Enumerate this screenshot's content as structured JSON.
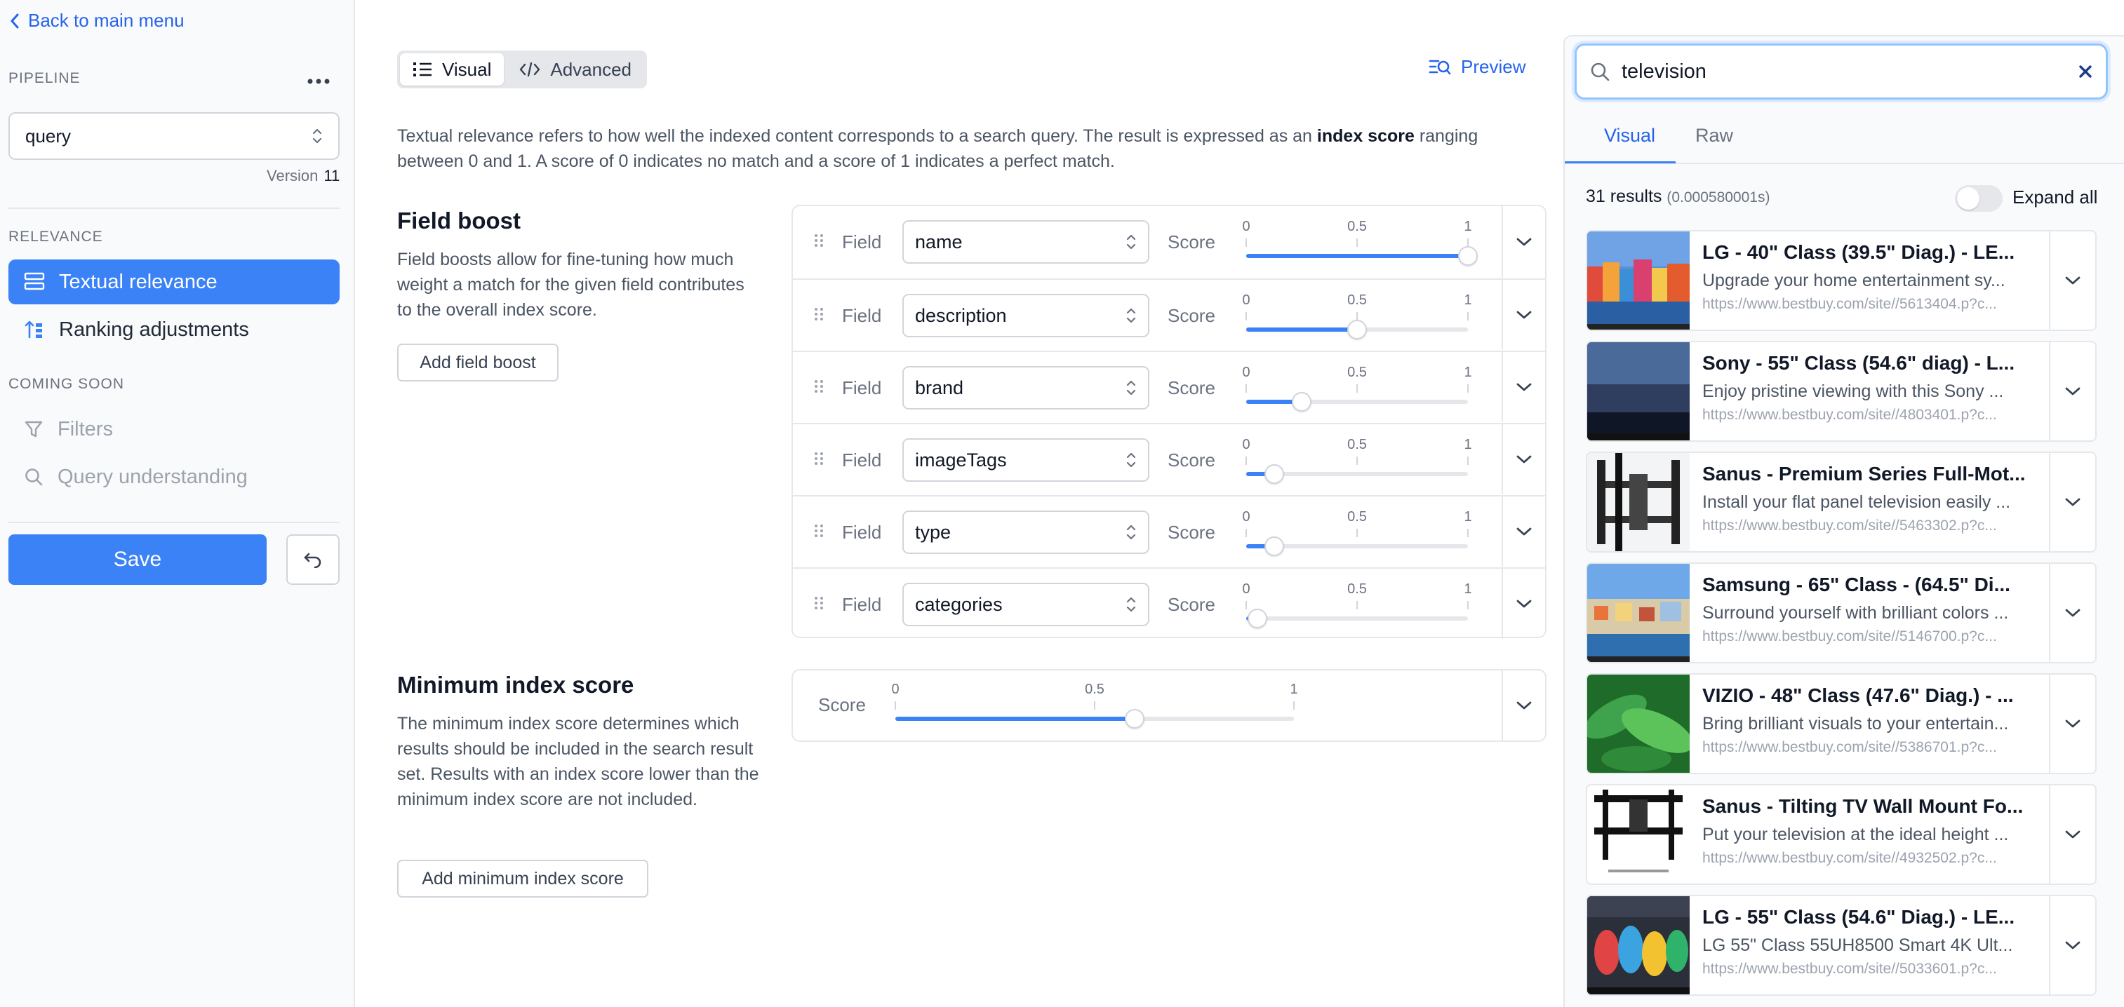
{
  "sidebar": {
    "back_label": "Back to main menu",
    "pipeline_title": "PIPELINE",
    "pipeline_value": "query",
    "version_label": "Version",
    "version_number": "11",
    "relevance_title": "RELEVANCE",
    "relevance_items": [
      {
        "label": "Textual relevance",
        "icon": "list-icon",
        "active": true
      },
      {
        "label": "Ranking adjustments",
        "icon": "sort-icon",
        "active": false
      }
    ],
    "coming_soon_title": "COMING SOON",
    "coming_soon_items": [
      {
        "label": "Filters",
        "icon": "filter-icon"
      },
      {
        "label": "Query understanding",
        "icon": "search-icon"
      }
    ],
    "save_label": "Save",
    "undo_icon": "undo-icon"
  },
  "main": {
    "mode_tabs": [
      {
        "label": "Visual",
        "icon": "list-icon",
        "active": true
      },
      {
        "label": "Advanced",
        "icon": "code-icon",
        "active": false
      }
    ],
    "preview_label": "Preview",
    "intro_text": "Textual relevance refers to how well the indexed content corresponds to a search query. The result is expressed as an",
    "intro_bold": "index score",
    "intro_text_2": "ranging between 0 and 1. A score of 0 indicates no match and a score of 1 indicates a perfect match.",
    "field_boost": {
      "title": "Field boost",
      "description": "Field boosts allow for fine-tuning how much weight a match for the given field contributes to the overall index score.",
      "add_label": "Add field boost",
      "field_label": "Field",
      "score_label": "Score",
      "tick_labels": [
        "0",
        "0.5",
        "1"
      ],
      "rows": [
        {
          "field": "name",
          "score": 1.0
        },
        {
          "field": "description",
          "score": 0.5
        },
        {
          "field": "brand",
          "score": 0.25
        },
        {
          "field": "imageTags",
          "score": 0.125
        },
        {
          "field": "type",
          "score": 0.125
        },
        {
          "field": "categories",
          "score": 0.05
        }
      ]
    },
    "min_score": {
      "title": "Minimum index score",
      "description": "The minimum index score determines which results should be included in the search result set. Results with an index score lower than the minimum index score are not included.",
      "add_label": "Add minimum index score",
      "score_label": "Score",
      "tick_labels": [
        "0",
        "0.5",
        "1"
      ],
      "score": 0.6
    }
  },
  "results_panel": {
    "search_value": "television",
    "tabs": [
      "Visual",
      "Raw"
    ],
    "active_tab": "Visual",
    "count_label": "31 results",
    "time_label": "(0.000580001s)",
    "expand_all_label": "Expand all",
    "expand_all_on": false,
    "results": [
      {
        "title": "LG - 40\" Class (39.5\" Diag.) - LE...",
        "desc": "Upgrade your home entertainment sy...",
        "url": "https://www.bestbuy.com/site//5613404.p?c...",
        "thumb": "colorful-houses"
      },
      {
        "title": "Sony - 55\" Class (54.6\" diag) - L...",
        "desc": "Enjoy pristine viewing with this Sony ...",
        "url": "https://www.bestbuy.com/site//4803401.p?c...",
        "thumb": "night-sky"
      },
      {
        "title": "Sanus - Premium Series Full-Mot...",
        "desc": "Install your flat panel television easily ...",
        "url": "https://www.bestbuy.com/site//5463302.p?c...",
        "thumb": "wall-mount"
      },
      {
        "title": "Samsung - 65\" Class - (64.5\" Di...",
        "desc": "Surround yourself with brilliant colors ...",
        "url": "https://www.bestbuy.com/site//5146700.p?c...",
        "thumb": "coastal-town"
      },
      {
        "title": "VIZIO - 48\" Class (47.6\" Diag.) - ...",
        "desc": "Bring brilliant visuals to your entertain...",
        "url": "https://www.bestbuy.com/site//5386701.p?c...",
        "thumb": "green-leaves"
      },
      {
        "title": "Sanus - Tilting TV Wall Mount Fo...",
        "desc": "Put your television at the ideal height ...",
        "url": "https://www.bestbuy.com/site//4932502.p?c...",
        "thumb": "tilt-mount"
      },
      {
        "title": "LG - 55\" Class (54.6\" Diag.) - LE...",
        "desc": "LG 55\" Class 55UH8500 Smart 4K Ult...",
        "url": "https://www.bestbuy.com/site//5033601.p?c...",
        "thumb": "hot-air-balloons"
      }
    ]
  },
  "colors": {
    "accent": "#3b82f6",
    "link": "#2563eb",
    "border": "#e5e7eb"
  }
}
